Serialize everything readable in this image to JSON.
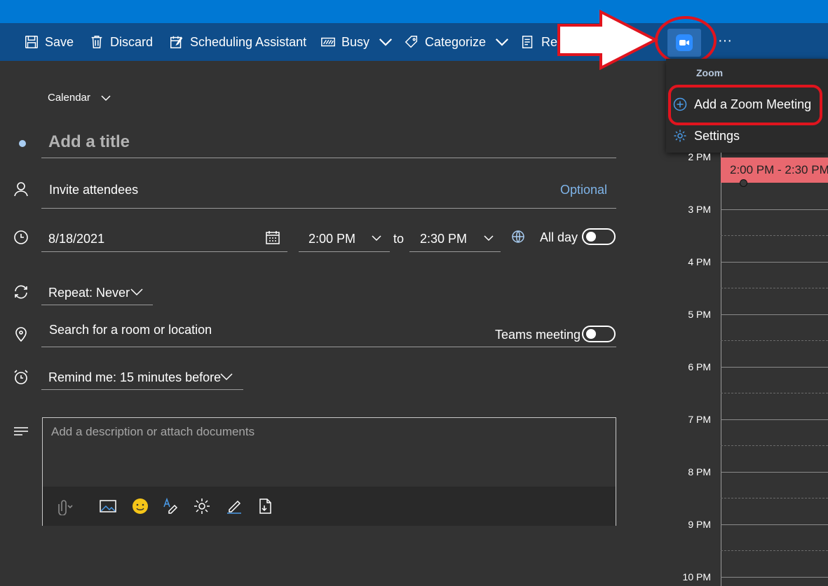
{
  "toolbar": {
    "save": "Save",
    "discard": "Discard",
    "scheduling": "Scheduling Assistant",
    "busy": "Busy",
    "categorize": "Categorize",
    "response_partial": "Res",
    "more": "···"
  },
  "zoom_menu": {
    "header": "Zoom",
    "add_meeting": "Add a Zoom Meeting",
    "settings": "Settings"
  },
  "form": {
    "calendar_label": "Calendar",
    "title_placeholder": "Add a title",
    "invite_placeholder": "Invite attendees",
    "optional_link": "Optional",
    "date": "8/18/2021",
    "start_time": "2:00 PM",
    "to_label": "to",
    "end_time": "2:30 PM",
    "all_day": "All day",
    "repeat": "Repeat:  Never",
    "location_placeholder": "Search for a room or location",
    "teams_meeting": "Teams meeting",
    "remind": "Remind me:  15 minutes before",
    "description_placeholder": "Add a description or attach documents"
  },
  "calendar_view": {
    "hours": [
      "2 PM",
      "3 PM",
      "4 PM",
      "5 PM",
      "6 PM",
      "7 PM",
      "8 PM",
      "9 PM",
      "10 PM"
    ],
    "event_time": "2:00 PM - 2:30 PM"
  },
  "colors": {
    "accent": "#0078d4",
    "toolbar": "#0f4d8a",
    "annotation_red": "#e0141e",
    "event": "#e8686f"
  }
}
